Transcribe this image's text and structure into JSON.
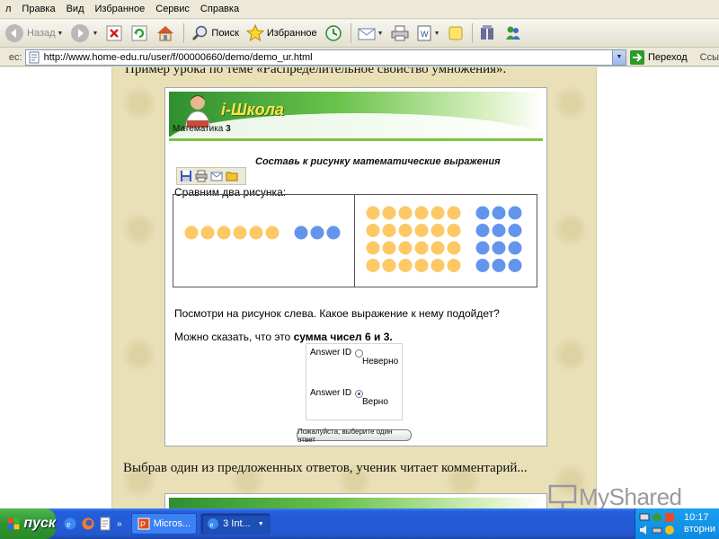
{
  "menu": [
    "л",
    "Правка",
    "Вид",
    "Избранное",
    "Сервис",
    "Справка"
  ],
  "toolbar": {
    "back_label": "Назад",
    "search_label": "Поиск",
    "favorites_label": "Избранное"
  },
  "address": {
    "label": "ес:",
    "url": "http://www.home-edu.ru/user/f/00000660/demo/demo_ur.html",
    "go_label": "Переход",
    "links_label": "Ссы"
  },
  "slide": {
    "top_text": "Пример урока по теме «Распределительное свойство умножения».",
    "bottom_text": "Выбрав один из предложенных ответов, ученик читает комментарий..."
  },
  "lesson": {
    "logo": "i-Школа",
    "subject": "Математика",
    "grade": "3",
    "task_title": "Составь к рисунку математические выражения",
    "compare_label": "Сравним два рисунка:",
    "question": "Посмотри на рисунок слева. Какое выражение к нему подойдет?",
    "statement_prefix": "Можно сказать, что это ",
    "statement_bold": "сумма чисел 6 и 3.",
    "answers": [
      {
        "id_label": "Answer ID",
        "text": "Неверно",
        "selected": false
      },
      {
        "id_label": "Answer ID",
        "text": "Верно",
        "selected": true
      }
    ],
    "submit_label": "Пожалуйста, выберите один ответ",
    "left_picture": {
      "yellow": 6,
      "blue": 3
    },
    "right_picture": {
      "yellow_rows": 4,
      "yellow_cols": 6,
      "blue_rows": 4,
      "blue_cols": 3
    },
    "colors": {
      "yellow": "#fdc865",
      "blue": "#6495ed"
    }
  },
  "watermark": "MyShared",
  "taskbar": {
    "start_label": "пуск",
    "chevron": "»",
    "tasks": [
      {
        "label": "Micros...",
        "active": false
      },
      {
        "label": "3 Int...",
        "active": true
      }
    ],
    "clock_time": "10:17",
    "clock_day": "вторни"
  }
}
